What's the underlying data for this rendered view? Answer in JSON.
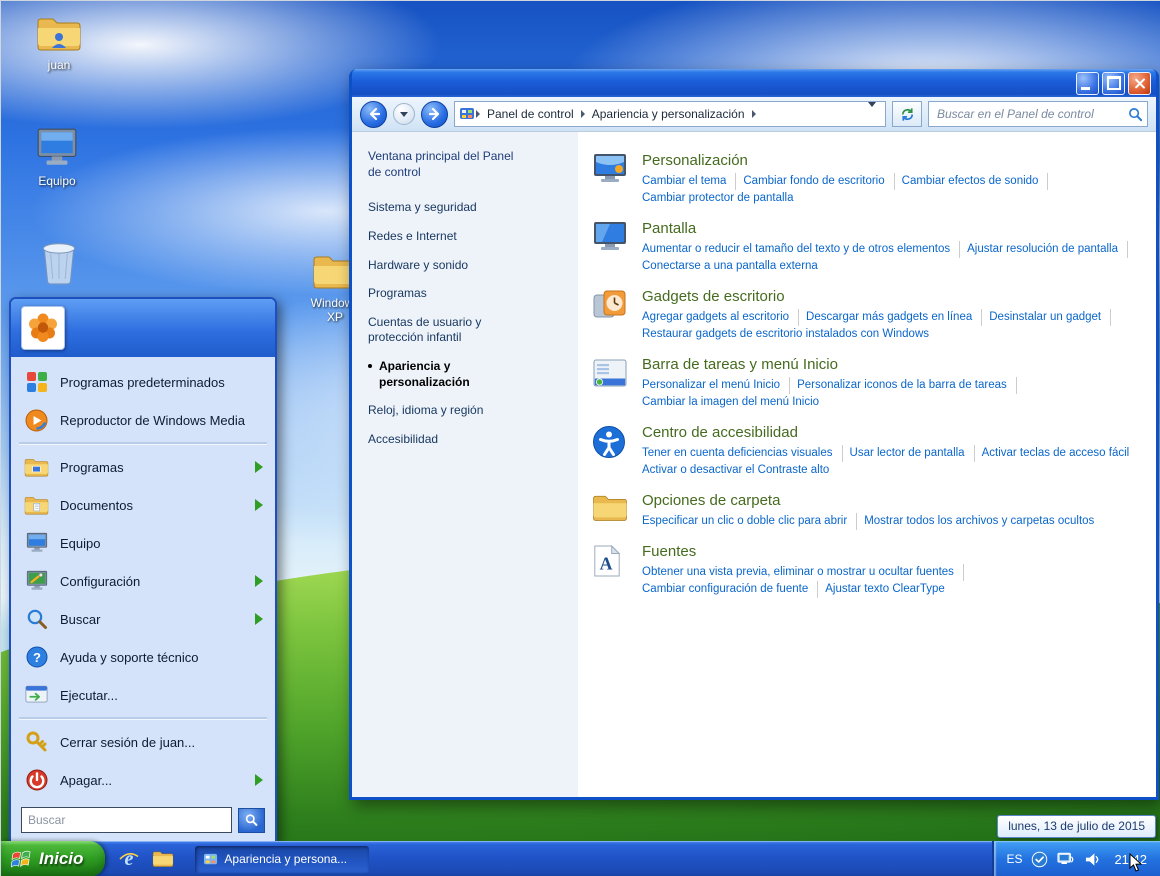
{
  "colors": {
    "taskbar_blue": "#2053c7",
    "start_button_green": "#2f9e23",
    "heading_green": "#456b1f",
    "task_link_blue": "#0a66cb",
    "window_chrome_blue": "#1b5cd8",
    "start_menu_bg": "#d4e3f9"
  },
  "desktop": {
    "icons": [
      {
        "label": "juan",
        "icon": "user-folder-icon"
      },
      {
        "label": "Equipo",
        "icon": "computer-icon"
      },
      {
        "label": "",
        "icon": "recycle-bin-icon"
      },
      {
        "label": "Windows XP",
        "icon": "folder-icon"
      }
    ]
  },
  "start_menu": {
    "pinned": [
      {
        "label": "Programas predeterminados",
        "icon": "default-programs-icon"
      },
      {
        "label": "Reproductor de Windows Media",
        "icon": "windows-media-player-icon"
      }
    ],
    "items": [
      {
        "label": "Programas",
        "icon": "programs-folder-icon",
        "submenu": true
      },
      {
        "label": "Documentos",
        "icon": "documents-folder-icon",
        "submenu": true
      },
      {
        "label": "Equipo",
        "icon": "computer-icon",
        "submenu": false
      },
      {
        "label": "Configuración",
        "icon": "settings-icon",
        "submenu": true
      },
      {
        "label": "Buscar",
        "icon": "search-icon",
        "submenu": true
      },
      {
        "label": "Ayuda y soporte técnico",
        "icon": "help-icon",
        "submenu": false
      },
      {
        "label": "Ejecutar...",
        "icon": "run-icon",
        "submenu": false
      }
    ],
    "footer": [
      {
        "label": "Cerrar sesión de juan...",
        "icon": "log-off-icon",
        "submenu": false
      },
      {
        "label": "Apagar...",
        "icon": "shutdown-icon",
        "submenu": true
      }
    ],
    "search_placeholder": "Buscar"
  },
  "window": {
    "breadcrumb": {
      "root": "Panel de control",
      "current": "Apariencia y personalización"
    },
    "search_placeholder": "Buscar en el Panel de control",
    "sidebar": {
      "home": "Ventana principal del Panel de control",
      "items": [
        "Sistema y seguridad",
        "Redes e Internet",
        "Hardware y sonido",
        "Programas",
        "Cuentas de usuario y protección infantil",
        "Apariencia y personalización",
        "Reloj, idioma y región",
        "Accesibilidad"
      ],
      "selected": "Apariencia y personalización"
    },
    "sections": [
      {
        "title": "Personalización",
        "icon": "personalization-icon",
        "rows": [
          [
            "Cambiar el tema",
            "Cambiar fondo de escritorio",
            "Cambiar efectos de sonido"
          ],
          [
            "Cambiar protector de pantalla"
          ]
        ]
      },
      {
        "title": "Pantalla",
        "icon": "display-icon",
        "rows": [
          [
            "Aumentar o reducir el tamaño del texto y de otros elementos",
            "Ajustar resolución de pantalla"
          ],
          [
            "Conectarse a una pantalla externa"
          ]
        ]
      },
      {
        "title": "Gadgets de escritorio",
        "icon": "desktop-gadgets-icon",
        "rows": [
          [
            "Agregar gadgets al escritorio",
            "Descargar más gadgets en línea",
            "Desinstalar un gadget"
          ],
          [
            "Restaurar gadgets de escritorio instalados con Windows"
          ]
        ]
      },
      {
        "title": "Barra de tareas y menú Inicio",
        "icon": "taskbar-start-menu-icon",
        "rows": [
          [
            "Personalizar el menú Inicio",
            "Personalizar iconos de la barra de tareas"
          ],
          [
            "Cambiar la imagen del menú Inicio"
          ]
        ]
      },
      {
        "title": "Centro de accesibilidad",
        "icon": "ease-of-access-icon",
        "rows": [
          [
            "Tener en cuenta deficiencias visuales",
            "Usar lector de pantalla",
            "Activar teclas de acceso fácil"
          ],
          [
            "Activar o desactivar el Contraste alto"
          ]
        ]
      },
      {
        "title": "Opciones de carpeta",
        "icon": "folder-options-icon",
        "rows": [
          [
            "Especificar un clic o doble clic para abrir",
            "Mostrar todos los archivos y carpetas ocultos"
          ]
        ]
      },
      {
        "title": "Fuentes",
        "icon": "fonts-icon",
        "rows": [
          [
            "Obtener una vista previa, eliminar o mostrar u ocultar fuentes"
          ],
          [
            "Cambiar configuración de fuente",
            "Ajustar texto ClearType"
          ]
        ]
      }
    ]
  },
  "taskbar": {
    "start_label": "Inicio",
    "task_button": {
      "label": "Apariencia y persona..."
    },
    "tray": {
      "language": "ES",
      "time": "21:42"
    },
    "date_tooltip": "lunes, 13 de julio de 2015"
  }
}
